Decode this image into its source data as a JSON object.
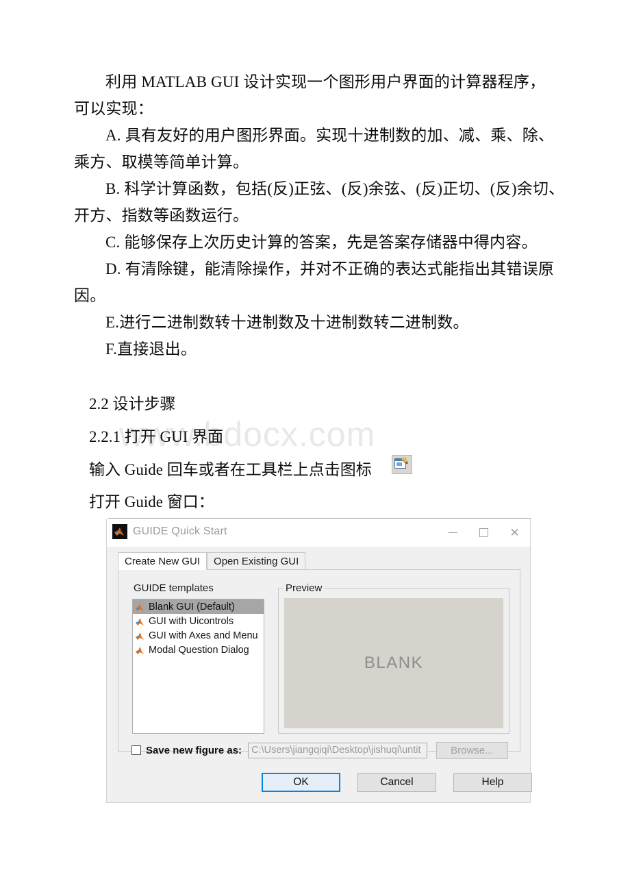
{
  "document": {
    "paragraphs": [
      "利用 MATLAB GUI 设计实现一个图形用户界面的计算器程序，可以实现：",
      "A. 具有友好的用户图形界面。实现十进制数的加、减、乘、除、乘方、取模等简单计算。",
      "B. 科学计算函数，包括(反)正弦、(反)余弦、(反)正切、(反)余切、开方、指数等函数运行。",
      "C. 能够保存上次历史计算的答案，先是答案存储器中得内容。",
      "D. 有清除键，能清除操作，并对不正确的表达式能指出其错误原因。",
      "E.进行二进制数转十进制数及十进制数转二进制数。",
      "F.直接退出。"
    ],
    "headings": {
      "section": "2.2 设计步骤",
      "subsection": "2.2.1 打开 GUI 界面",
      "instruction": "输入 Guide 回车或者在工具栏上点击图标",
      "open_window": "打开 Guide 窗口："
    },
    "watermark": "www.bdocx.com",
    "scan_remnant": "¯ ¯ ¯¯ ¯¯¯¯ ¯ ¯"
  },
  "dialog": {
    "title": "GUIDE Quick Start",
    "window_controls": {
      "minimize": "minimize",
      "maximize": "maximize",
      "close": "close"
    },
    "tabs": [
      {
        "label": "Create New GUI",
        "active": true
      },
      {
        "label": "Open Existing GUI",
        "active": false
      }
    ],
    "templates_group_label": "GUIDE templates",
    "templates": [
      {
        "label": "Blank GUI (Default)",
        "selected": true
      },
      {
        "label": "GUI with Uicontrols",
        "selected": false
      },
      {
        "label": "GUI with Axes and Menu",
        "selected": false
      },
      {
        "label": "Modal Question Dialog",
        "selected": false
      }
    ],
    "preview_group_label": "Preview",
    "preview_text": "BLANK",
    "save_row": {
      "checkbox_checked": false,
      "label": "Save new figure as:",
      "path_value": "C:\\Users\\jiangqiqi\\Desktop\\jishuqi\\untit",
      "browse_label": "Browse..."
    },
    "buttons": {
      "ok": "OK",
      "cancel": "Cancel",
      "help": "Help"
    }
  },
  "colors": {
    "dialog_bg": "#f0f0f0",
    "titlebar_bg": "#ffffff",
    "selection": "#a6a6a6",
    "preview_canvas": "#d6d2cc",
    "focus_border": "#0a84e0",
    "watermark": "#e8e8e8",
    "matlab_orange": "#e8701a"
  }
}
